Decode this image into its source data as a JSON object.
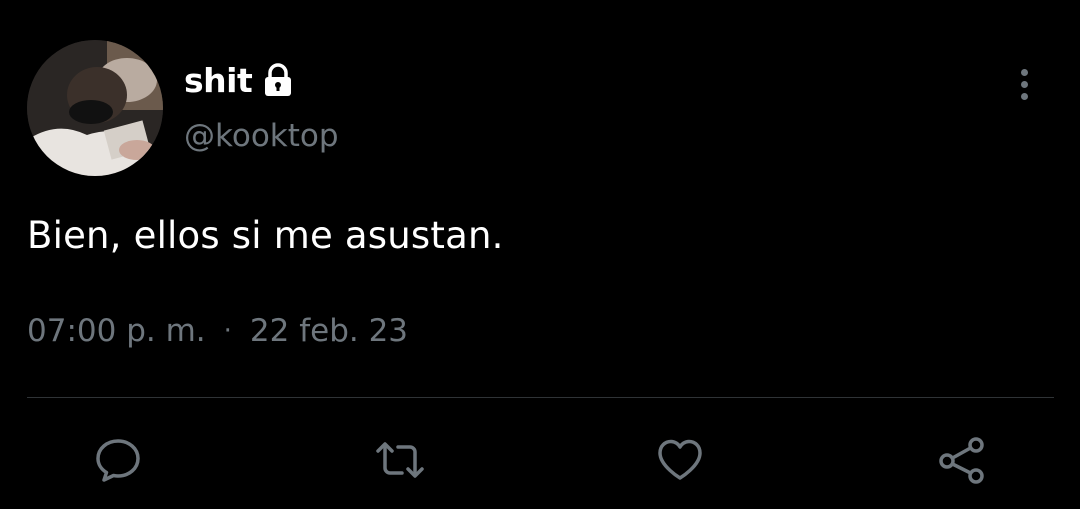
{
  "tweet": {
    "display_name": "shit",
    "handle": "@kooktop",
    "text": "Bien, ellos si me asustan.",
    "time": "07:00 p. m.",
    "separator": "·",
    "date": "22 feb. 23"
  },
  "icons": {
    "protected": "lock-icon",
    "more": "more-vertical-icon",
    "reply": "comment-icon",
    "retweet": "retweet-icon",
    "like": "heart-icon",
    "share": "share-icon"
  },
  "colors": {
    "background": "#000000",
    "primary_text": "#ffffff",
    "secondary_text": "#6e767d",
    "divider": "#2f3336"
  }
}
